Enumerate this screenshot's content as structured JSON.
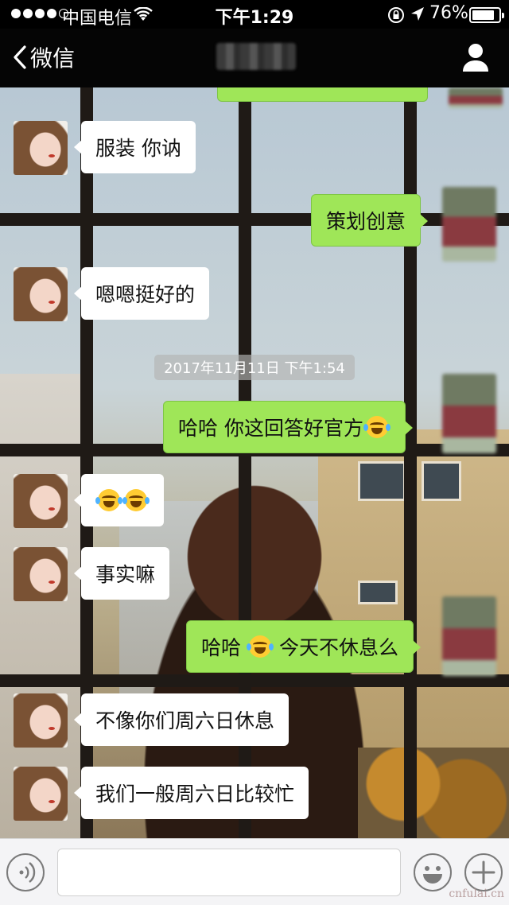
{
  "status_bar": {
    "carrier": "中国电信",
    "time": "下午1:29",
    "battery_percent": "76%",
    "battery_level": 0.76,
    "signal_bars_filled": 4,
    "signal_bars_total": 5
  },
  "nav_bar": {
    "back_label": "微信",
    "back_icon": "chevron-left-icon",
    "profile_icon": "person-icon"
  },
  "timestamp": "2017年11月11日 下午1:54",
  "messages": [
    {
      "side": "in",
      "text": "服装 你讷"
    },
    {
      "side": "out",
      "text": "策划创意"
    },
    {
      "side": "in",
      "text": "嗯嗯挺好的"
    },
    {
      "side": "out",
      "text": "哈哈 你这回答好官方",
      "emoji_after": "laugh-cry-emoji"
    },
    {
      "side": "in",
      "emoji": [
        "laugh-cry-emoji",
        "laugh-cry-emoji"
      ]
    },
    {
      "side": "in",
      "text": "事实嘛"
    },
    {
      "side": "out",
      "text_before": "哈哈",
      "emoji": "laugh-cry-emoji",
      "text_after": "今天不休息么"
    },
    {
      "side": "in",
      "text": "不像你们周六日休息"
    },
    {
      "side": "in",
      "text": "我们一般周六日比较忙"
    }
  ],
  "input_bar": {
    "voice_icon": "voice-icon",
    "input_value": "",
    "emoji_icon": "smiley-icon",
    "plus_icon": "plus-icon"
  },
  "watermark": "cnfulai.cn"
}
